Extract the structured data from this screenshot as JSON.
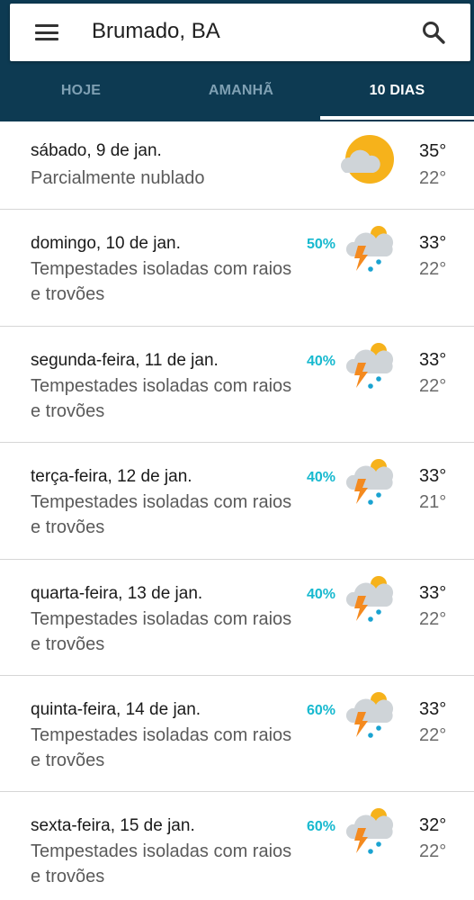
{
  "search": {
    "location": "Brumado, BA"
  },
  "tabs": [
    {
      "label": "HOJE",
      "selected": false
    },
    {
      "label": "AMANHÃ",
      "selected": false
    },
    {
      "label": "10 DIAS",
      "selected": true
    }
  ],
  "colors": {
    "app_bar": "#0d3a52",
    "precip": "#17b9cf",
    "sun": "#f6b21b",
    "cloud": "#cfd4d8",
    "bolt": "#f48a1f",
    "rain": "#1aa3d1"
  },
  "days": [
    {
      "date": "sábado, 9 de jan.",
      "condition": "Parcialmente nublado",
      "precip": "",
      "high": "35°",
      "low": "22°",
      "icon": "partly-cloudy-icon"
    },
    {
      "date": "domingo, 10 de jan.",
      "condition": "Tempestades isoladas com raios e trovões",
      "precip": "50%",
      "high": "33°",
      "low": "22°",
      "icon": "thunderstorm-icon"
    },
    {
      "date": "segunda-feira, 11 de jan.",
      "condition": "Tempestades isoladas com raios e trovões",
      "precip": "40%",
      "high": "33°",
      "low": "22°",
      "icon": "thunderstorm-icon"
    },
    {
      "date": "terça-feira, 12 de jan.",
      "condition": "Tempestades isoladas com raios e trovões",
      "precip": "40%",
      "high": "33°",
      "low": "21°",
      "icon": "thunderstorm-icon"
    },
    {
      "date": "quarta-feira, 13 de jan.",
      "condition": "Tempestades isoladas com raios e trovões",
      "precip": "40%",
      "high": "33°",
      "low": "22°",
      "icon": "thunderstorm-icon"
    },
    {
      "date": "quinta-feira, 14 de jan.",
      "condition": "Tempestades isoladas com raios e trovões",
      "precip": "60%",
      "high": "33°",
      "low": "22°",
      "icon": "thunderstorm-icon"
    },
    {
      "date": "sexta-feira, 15 de jan.",
      "condition": "Tempestades isoladas com raios e trovões",
      "precip": "60%",
      "high": "32°",
      "low": "22°",
      "icon": "thunderstorm-icon"
    }
  ]
}
